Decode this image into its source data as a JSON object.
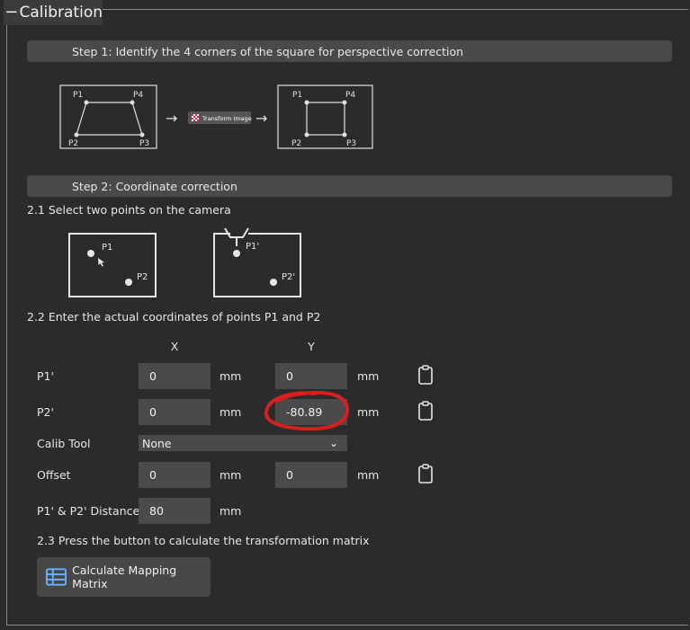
{
  "group": {
    "collapse_glyph": "−",
    "title": "Calibration"
  },
  "step1": {
    "title": "Step 1: Identify the 4 corners of the square for perspective correction",
    "left_points": [
      "P1",
      "P4",
      "P2",
      "P3"
    ],
    "right_points": [
      "P1",
      "P4",
      "P2",
      "P3"
    ],
    "arrow": "→",
    "transform_label": "Transform Image"
  },
  "step2": {
    "title": "Step 2: Coordinate correction",
    "sub1": "2.1 Select two points on the camera",
    "cam_points": [
      "P1",
      "P2"
    ],
    "actual_points": [
      "P1'",
      "P2'"
    ],
    "sub2": "2.2 Enter the actual coordinates of points P1 and P2",
    "col_x": "X",
    "col_y": "Y",
    "rows": [
      {
        "label": "P1'",
        "x": "0",
        "y": "0",
        "unit": "mm"
      },
      {
        "label": "P2'",
        "x": "0",
        "y": "-80.89",
        "unit": "mm"
      }
    ],
    "calib_tool": {
      "label": "Calib Tool",
      "value": "None",
      "chevron": "⌄"
    },
    "offset": {
      "label": "Offset",
      "x": "0",
      "y": "0",
      "unit": "mm"
    },
    "distance": {
      "label": "P1' & P2' Distance",
      "value": "80",
      "unit": "mm"
    },
    "sub3": "2.3 Press the button to calculate the transformation matrix",
    "calc_button": "Calculate Mapping Matrix"
  },
  "colors": {
    "annotation": "#d81e1e",
    "icon_blue": "#6ab0ff",
    "background": "#2b2b2b"
  },
  "icons": [
    "collapse-icon",
    "clipboard-icon",
    "table-icon",
    "cursor-icon",
    "checkerboard-icon"
  ]
}
